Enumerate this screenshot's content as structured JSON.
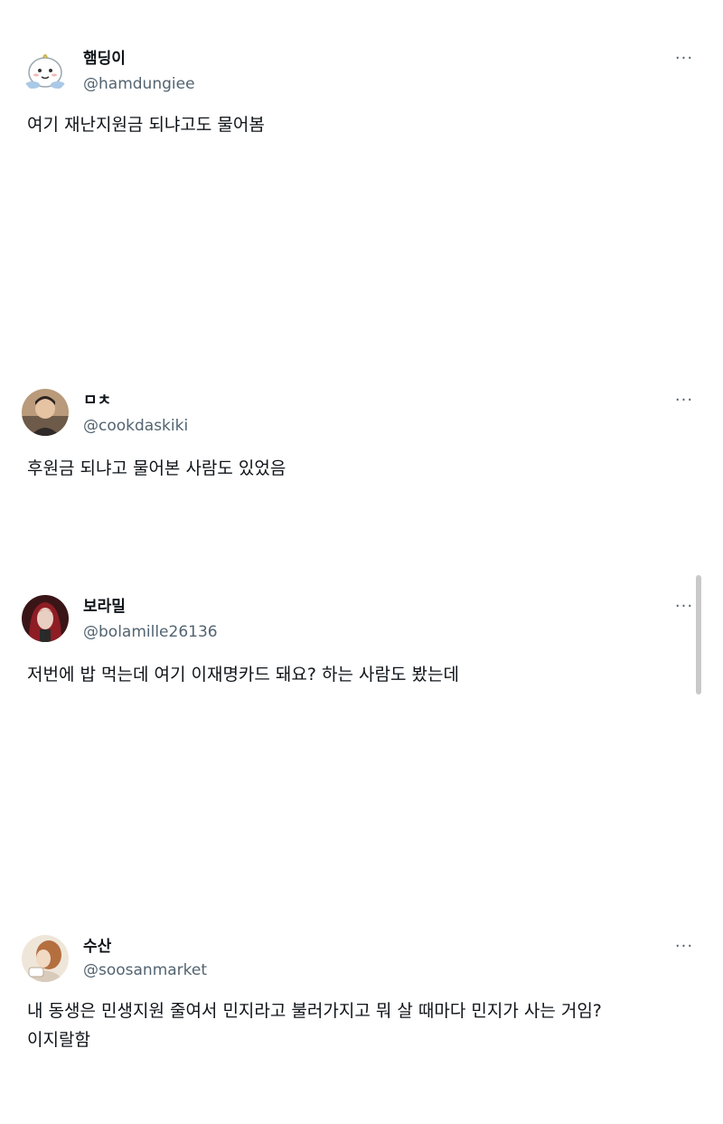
{
  "more_glyph": "···",
  "tweets": [
    {
      "name": "햄딩이",
      "handle": "@hamdungiee",
      "lines": [
        "여기 재난지원금 되냐고도 물어봄"
      ],
      "avatar": "cartoon-character-avatar"
    },
    {
      "name": "ㅁㅊ",
      "handle": "@cookdaskiki",
      "lines": [
        "후원금 되냐고 물어본 사람도 있었음"
      ],
      "avatar": "person-photo-avatar"
    },
    {
      "name": "보라밀",
      "handle": "@bolamille26136",
      "lines": [
        "저번에 밥 먹는데 여기 이재명카드 돼요? 하는 사람도 봤는데"
      ],
      "avatar": "red-haired-illustration-avatar"
    },
    {
      "name": "수산",
      "handle": "@soosanmarket",
      "lines": [
        "내 동생은 민생지원 줄여서 민지라고 불러가지고 뭐 살 때마다 민지가 사는 거임?",
        "이지랄함"
      ],
      "avatar": "illustration-avatar"
    }
  ],
  "colors": {
    "text_primary": "#0f1419",
    "text_secondary": "#536471",
    "background": "#ffffff",
    "scrollbar": "#c9c9c9"
  }
}
